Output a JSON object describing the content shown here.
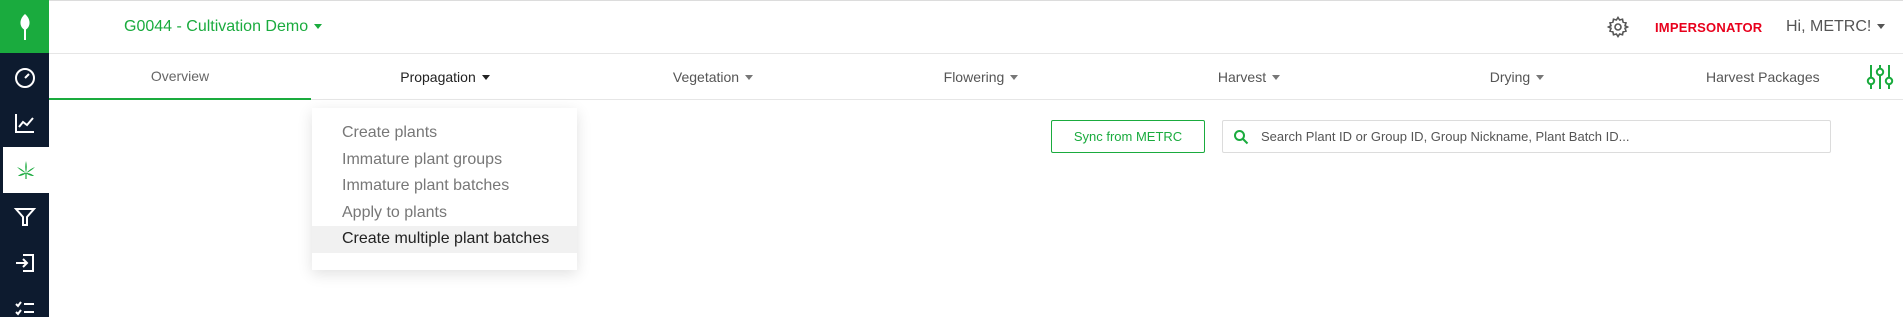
{
  "sidebar": {
    "logo_icon": "leaf-logo-icon",
    "items": [
      {
        "name": "dashboard",
        "icon": "speedometer-icon"
      },
      {
        "name": "reports",
        "icon": "line-chart-icon"
      },
      {
        "name": "cultivation",
        "icon": "cannabis-leaf-icon",
        "active": true
      },
      {
        "name": "processing",
        "icon": "funnel-icon"
      },
      {
        "name": "transfers",
        "icon": "sign-in-icon"
      },
      {
        "name": "tasks",
        "icon": "checklist-icon"
      }
    ]
  },
  "header": {
    "facility": "G0044 - Cultivation Demo",
    "settings_icon": "gear-icon",
    "impersonator": "IMPERSONATOR",
    "greeting": "Hi, METRC!"
  },
  "tabs": [
    {
      "label": "Overview",
      "active": true
    },
    {
      "label": "Propagation",
      "open": true
    },
    {
      "label": "Vegetation"
    },
    {
      "label": "Flowering"
    },
    {
      "label": "Harvest"
    },
    {
      "label": "Drying"
    },
    {
      "label": "Harvest Packages"
    }
  ],
  "propagation_menu": [
    "Create plants",
    "Immature plant groups",
    "Immature plant batches",
    "Apply to plants",
    "Create multiple plant batches"
  ],
  "toolbar": {
    "sync_label": "Sync from METRC",
    "search_placeholder": "Search Plant ID or Group ID, Group Nickname, Plant Batch ID..."
  },
  "colors": {
    "brand_green": "#1aab3e",
    "sidebar_bg": "#0d1b2f",
    "impersonator_red": "#e8001c"
  }
}
